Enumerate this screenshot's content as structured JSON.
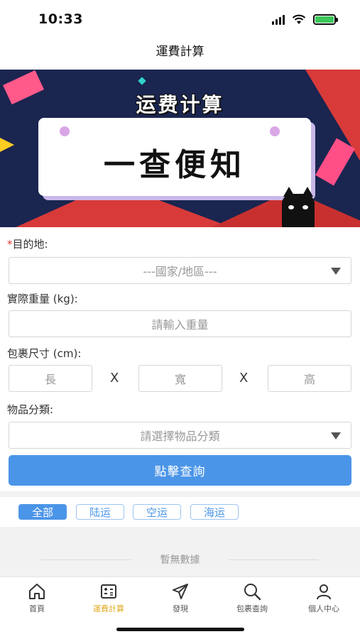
{
  "status": {
    "time": "10:33"
  },
  "nav": {
    "title": "運費計算"
  },
  "banner": {
    "subtitle": "运费计算",
    "headline": "一查便知"
  },
  "form": {
    "destination": {
      "required_mark": "*",
      "label": "目的地:",
      "placeholder": "---國家/地區---"
    },
    "weight": {
      "label": "實際重量 (kg):",
      "placeholder": "請輸入重量"
    },
    "size": {
      "label": "包裹尺寸 (cm):",
      "length": "長",
      "width": "寬",
      "height": "高",
      "separator": "X"
    },
    "category": {
      "label": "物品分類:",
      "placeholder": "請選擇物品分類"
    },
    "submit_label": "點擊查詢"
  },
  "filters": [
    {
      "label": "全部",
      "active": true
    },
    {
      "label": "陆运",
      "active": false
    },
    {
      "label": "空运",
      "active": false
    },
    {
      "label": "海运",
      "active": false
    }
  ],
  "results": {
    "empty_text": "暫無數據"
  },
  "tabbar": {
    "items": [
      {
        "label": "首頁",
        "icon": "home-icon"
      },
      {
        "label": "運費計算",
        "icon": "calculator-icon",
        "active": true
      },
      {
        "label": "發現",
        "icon": "send-icon"
      },
      {
        "label": "包裹查詢",
        "icon": "search-icon"
      },
      {
        "label": "個人中心",
        "icon": "user-icon"
      }
    ]
  },
  "colors": {
    "primary": "#4b95e8",
    "active_tab": "#e0a91c",
    "required": "#e23b3b"
  }
}
